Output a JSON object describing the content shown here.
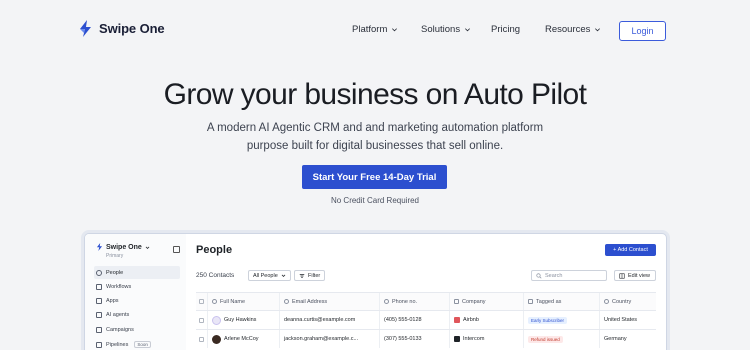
{
  "brand": {
    "name": "Swipe One",
    "accent": "#2c4fcf"
  },
  "nav": {
    "items": [
      {
        "label": "Platform",
        "has_menu": true
      },
      {
        "label": "Solutions",
        "has_menu": true
      },
      {
        "label": "Pricing",
        "has_menu": false
      },
      {
        "label": "Resources",
        "has_menu": true
      }
    ],
    "login_label": "Login"
  },
  "hero": {
    "title": "Grow your business on Auto Pilot",
    "subtitle_line1": "A modern AI Agentic CRM and  and marketing automation platform",
    "subtitle_line2": "purpose built for digital businesses that sell online.",
    "cta_label": "Start Your Free 14-Day Trial",
    "cta_note": "No Credit Card Required"
  },
  "app": {
    "workspace": {
      "name": "Swipe One",
      "sub": "Primary"
    },
    "sidebar": [
      {
        "label": "People",
        "icon": "person-icon",
        "active": true
      },
      {
        "label": "Workflows",
        "icon": "workflow-icon",
        "active": false
      },
      {
        "label": "Apps",
        "icon": "apps-icon",
        "active": false
      },
      {
        "label": "AI agents",
        "icon": "ai-agent-icon",
        "active": false
      },
      {
        "label": "Campaigns",
        "icon": "campaign-icon",
        "active": false
      },
      {
        "label": "Pipelines",
        "icon": "pipeline-icon",
        "active": false,
        "badge": "Soon"
      }
    ],
    "page_title": "People",
    "add_contact_label": "+ Add Contact",
    "count_label": "250 Contacts",
    "filter_all_label": "All People",
    "filter_label": "Filter",
    "search_placeholder": "Search",
    "edit_view_label": "Edit view",
    "columns": [
      "Full Name",
      "Email Address",
      "Phone no.",
      "Company",
      "Tagged as",
      "Country"
    ],
    "rows": [
      {
        "name": "Guy Hawkins",
        "email": "deanna.curtis@example.com",
        "phone": "(405) 555-0128",
        "company": "Airbnb",
        "company_color": "#e0565b",
        "tag": "Early Subscriber",
        "tag_bg": "#e6f0ff",
        "tag_fg": "#2c4fcf",
        "country": "United States",
        "avatar": "#e9e6f7"
      },
      {
        "name": "Arlene McCoy",
        "email": "jackson.graham@example.c...",
        "phone": "(307) 555-0133",
        "company": "Intercom",
        "company_color": "#1f2328",
        "tag": "Refund issued",
        "tag_bg": "#fde8e8",
        "tag_fg": "#c0392b",
        "country": "Germany",
        "avatar": "#3a2a22"
      }
    ]
  }
}
